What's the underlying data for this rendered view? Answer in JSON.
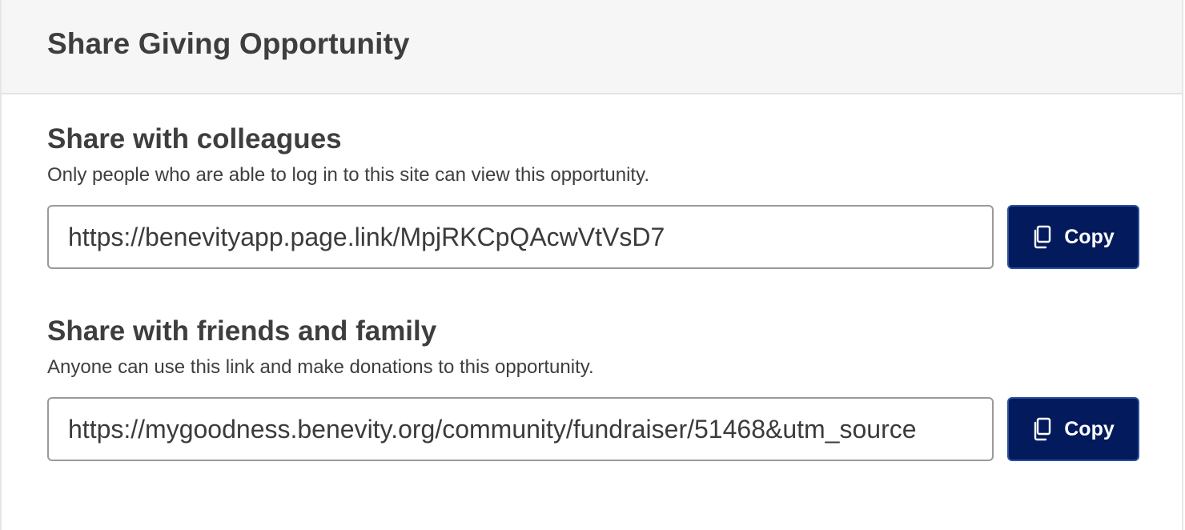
{
  "modal": {
    "title": "Share Giving Opportunity"
  },
  "sections": [
    {
      "title": "Share with colleagues",
      "description": "Only people who are able to log in to this site can view this opportunity.",
      "link": "https://benevityapp.page.link/MpjRKCpQAcwVtVsD7",
      "copy_label": "Copy",
      "copy_icon": "copy-icon"
    },
    {
      "title": "Share with friends and family",
      "description": "Anyone can use this link and make donations to this opportunity.",
      "link": "https://mygoodness.benevity.org/community/fundraiser/51468&utm_source",
      "copy_label": "Copy",
      "copy_icon": "copy-icon"
    }
  ],
  "colors": {
    "button_bg": "#031a5c",
    "header_bg": "#f6f6f6",
    "text": "#3e3e3e"
  }
}
